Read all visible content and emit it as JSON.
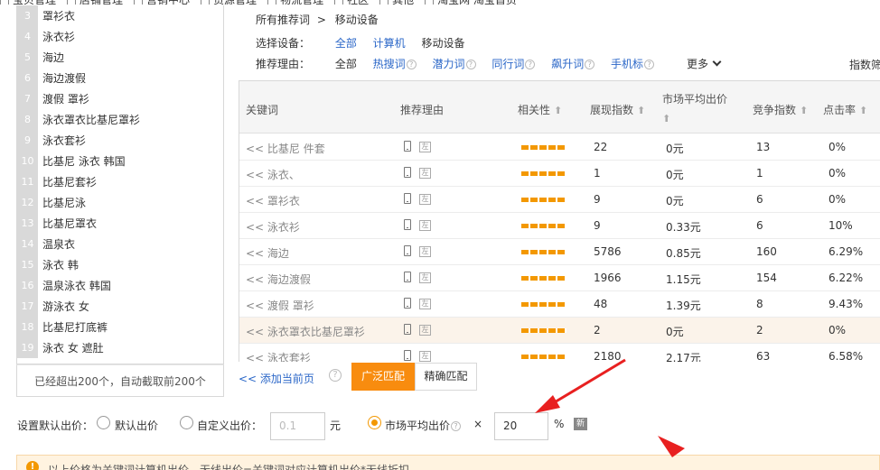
{
  "top_menu": [
    "宝贝管理",
    "店铺管理",
    "营销中心",
    "货源管理",
    "物流管理",
    "社区",
    "其他",
    "淘宝网 淘宝首页"
  ],
  "left_list": {
    "items": [
      {
        "num": "3",
        "text": "罩衫衣"
      },
      {
        "num": "4",
        "text": "泳衣衫"
      },
      {
        "num": "5",
        "text": "海边"
      },
      {
        "num": "6",
        "text": "海边渡假"
      },
      {
        "num": "7",
        "text": "渡假 罩衫"
      },
      {
        "num": "8",
        "text": "泳衣罩衣比基尼罩衫"
      },
      {
        "num": "9",
        "text": "泳衣套衫"
      },
      {
        "num": "10",
        "text": "比基尼 泳衣 韩国"
      },
      {
        "num": "11",
        "text": "比基尼套衫"
      },
      {
        "num": "12",
        "text": "比基尼泳"
      },
      {
        "num": "13",
        "text": "比基尼罩衣"
      },
      {
        "num": "14",
        "text": "温泉衣"
      },
      {
        "num": "15",
        "text": "泳衣 韩"
      },
      {
        "num": "16",
        "text": "温泉泳衣 韩国"
      },
      {
        "num": "17",
        "text": "游泳衣 女"
      },
      {
        "num": "18",
        "text": "比基尼打底裤"
      },
      {
        "num": "19",
        "text": "泳衣 女 遮肚"
      }
    ],
    "note": "已经超出200个，自动截取前200个"
  },
  "breadcrumb": {
    "root": "所有推荐词",
    "sep": ">",
    "current": "移动设备"
  },
  "filters": {
    "device_label": "选择设备：",
    "devices": [
      "全部",
      "计算机",
      "移动设备"
    ],
    "reason_label": "推荐理由：",
    "reasons": [
      "全部",
      "热搜词",
      "潜力词",
      "同行词",
      "飙升词",
      "手机标"
    ],
    "more": "更多",
    "index_label": "指数筛"
  },
  "table": {
    "headers": {
      "keyword": "关键词",
      "reason": "推荐理由",
      "relevance": "相关性",
      "impressions": "展现指数",
      "avg_bid": "市场平均出价",
      "competition": "竞争指数",
      "ctr": "点击率"
    },
    "sort_arrow": "⬆",
    "rows": [
      {
        "keyword": "<< 比基尼 件套",
        "impressions": "22",
        "avg_bid": "0元",
        "competition": "13",
        "ctr": "0%",
        "relevance": 5
      },
      {
        "keyword": "<< 泳衣、",
        "impressions": "1",
        "avg_bid": "0元",
        "competition": "1",
        "ctr": "0%",
        "relevance": 5
      },
      {
        "keyword": "<< 罩衫衣",
        "impressions": "9",
        "avg_bid": "0元",
        "competition": "6",
        "ctr": "0%",
        "relevance": 5
      },
      {
        "keyword": "<< 泳衣衫",
        "impressions": "9",
        "avg_bid": "0.33元",
        "competition": "6",
        "ctr": "10%",
        "relevance": 5
      },
      {
        "keyword": "<< 海边",
        "impressions": "5786",
        "avg_bid": "0.85元",
        "competition": "160",
        "ctr": "6.29%",
        "relevance": 5
      },
      {
        "keyword": "<< 海边渡假",
        "impressions": "1966",
        "avg_bid": "1.15元",
        "competition": "154",
        "ctr": "6.22%",
        "relevance": 5
      },
      {
        "keyword": "<< 渡假 罩衫",
        "impressions": "48",
        "avg_bid": "1.39元",
        "competition": "8",
        "ctr": "9.43%",
        "relevance": 5
      },
      {
        "keyword": "<< 泳衣罩衣比基尼罩衫",
        "impressions": "2",
        "avg_bid": "0元",
        "competition": "2",
        "ctr": "0%",
        "relevance": 5,
        "highlighted": true
      },
      {
        "keyword": "<< 泳衣套衫",
        "impressions": "2180",
        "avg_bid": "2.17元",
        "competition": "63",
        "ctr": "6.58%",
        "relevance": 5
      }
    ],
    "pc_icon_text": "左"
  },
  "footer": {
    "add_current": "<< 添加当前页",
    "broad_match": "广泛匹配",
    "exact_match": "精确匹配"
  },
  "bid": {
    "label": "设置默认出价：",
    "default_option": "默认出价",
    "custom_option": "自定义出价：",
    "custom_value": "0.1",
    "unit": "元",
    "market_option": "市场平均出价",
    "times": "×",
    "percent_value": "20",
    "percent_sign": "%",
    "new_badge": "新",
    "selected": "market"
  },
  "warning": {
    "text": "以上价格为关键词计算机出价，无线出价=关键词对应计算机出价*无线折扣"
  },
  "colors": {
    "accent_orange": "#f88c0f",
    "link_blue": "#2b67c8",
    "annotation_red": "#e82020"
  }
}
